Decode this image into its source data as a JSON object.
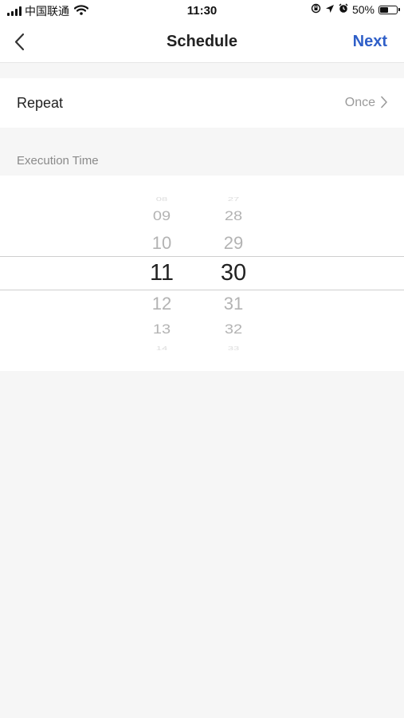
{
  "status_bar": {
    "carrier": "中国联通",
    "time": "11:30",
    "battery": "50%",
    "battery_level": 0.5
  },
  "nav": {
    "title": "Schedule",
    "next_label": "Next"
  },
  "repeat": {
    "label": "Repeat",
    "value": "Once"
  },
  "execution_section": {
    "label": "Execution Time"
  },
  "time_picker": {
    "hours": [
      "08",
      "09",
      "10",
      "11",
      "12",
      "13",
      "14"
    ],
    "minutes": [
      "27",
      "28",
      "29",
      "30",
      "31",
      "32",
      "33"
    ],
    "selected_hour": "11",
    "selected_minute": "30"
  },
  "colors": {
    "accent": "#2f5fc8",
    "background": "#f6f6f6"
  }
}
